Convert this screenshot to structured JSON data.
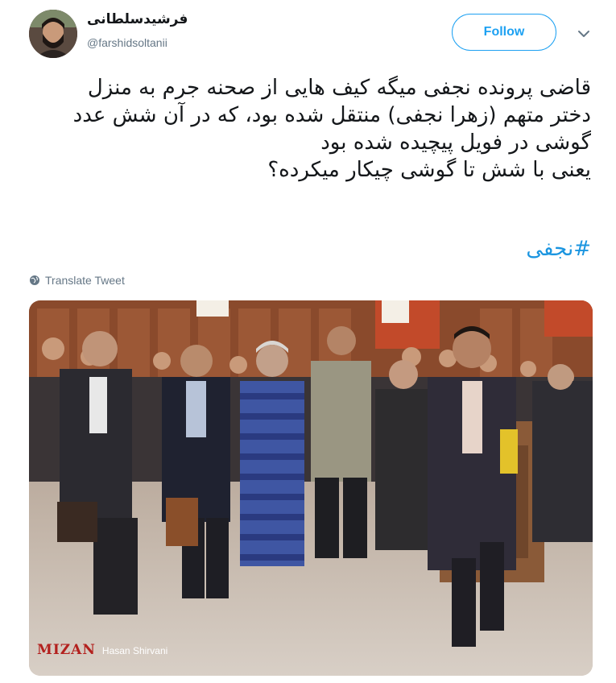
{
  "user": {
    "display_name": "فرشیدسلطانی",
    "handle": "@farshidsoltanii",
    "avatar_icon": "user-avatar"
  },
  "follow_button": {
    "label": "Follow",
    "color": "#1da1f2"
  },
  "menu_icon": "chevron-down-icon",
  "tweet": {
    "lines": [
      "قاضی پرونده نجفی میگه کیف هایی از صحنه جرم به منزل",
      "دختر متهم (زهرا نجفی) منتقل شده بود،  که در آن شش عدد",
      "گوشی  در فویل پیچیده شده بود",
      "یعنی با شش تا گوشی چیکار میکرده؟"
    ],
    "hashtag": "#نجفی"
  },
  "translate": {
    "label": "Translate Tweet",
    "icon": "globe-icon"
  },
  "photo": {
    "watermark_logo": "MIZAN",
    "watermark_credit": "Hasan Shirvani"
  },
  "colors": {
    "link": "#1b95e0",
    "muted": "#657786",
    "text": "#14171a"
  }
}
